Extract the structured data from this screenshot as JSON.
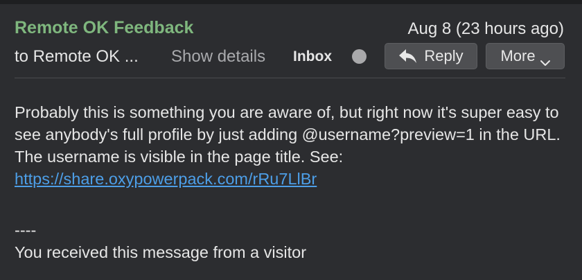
{
  "header": {
    "sender": "Remote OK Feedback",
    "date": "Aug 8 (23 hours ago)",
    "recipient": "to Remote OK ...",
    "show_details": "Show details",
    "mailbox": "Inbox",
    "reply_label": "Reply",
    "more_label": "More",
    "reply_icon": "reply-arrow",
    "more_icon": "chevron-down"
  },
  "message": {
    "body_prefix": "Probably this is something you are aware of, but right now it's super easy to see anybody's full profile by just adding @username?preview=1 in the URL. The username is visible in the page title. See: ",
    "link_text": "https://share.oxypowerpack.com/rRu7LlBr",
    "signature_separator": "----",
    "signature_text": "You received this message from a visitor"
  },
  "colors": {
    "background": "#2c2d30",
    "sender": "#7fb77e",
    "link": "#4d9fe8",
    "button": "#4e4f52"
  }
}
